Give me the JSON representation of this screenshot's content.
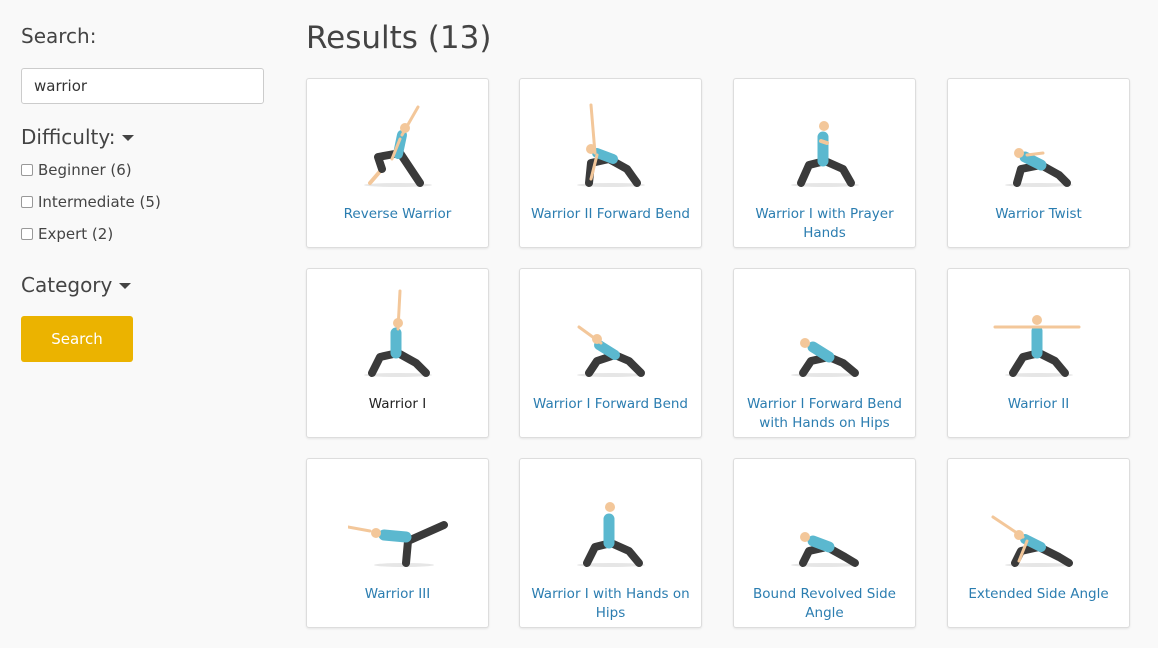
{
  "sidebar": {
    "search_label": "Search:",
    "search_value": "warrior",
    "difficulty_label": "Difficulty:",
    "difficulty_options": [
      "Beginner (6)",
      "Intermediate (5)",
      "Expert (2)"
    ],
    "category_label": "Category",
    "search_button": "Search"
  },
  "main": {
    "title": "Results (13)",
    "results": [
      {
        "label": "Reverse Warrior"
      },
      {
        "label": "Warrior II Forward Bend"
      },
      {
        "label": "Warrior I with Prayer Hands"
      },
      {
        "label": "Warrior Twist"
      },
      {
        "label": "Warrior I"
      },
      {
        "label": "Warrior I Forward Bend"
      },
      {
        "label": "Warrior I Forward Bend with Hands on Hips"
      },
      {
        "label": "Warrior II"
      },
      {
        "label": "Warrior III"
      },
      {
        "label": "Warrior I with Hands on Hips"
      },
      {
        "label": "Bound Revolved Side Angle"
      },
      {
        "label": "Extended Side Angle"
      }
    ]
  },
  "colors": {
    "accent": "#ebb300",
    "link": "#2b7db0",
    "top": "#5bb8cf",
    "pants": "#3a3a3a",
    "skin": "#f3c79a",
    "hair": "#8a4a2a"
  }
}
